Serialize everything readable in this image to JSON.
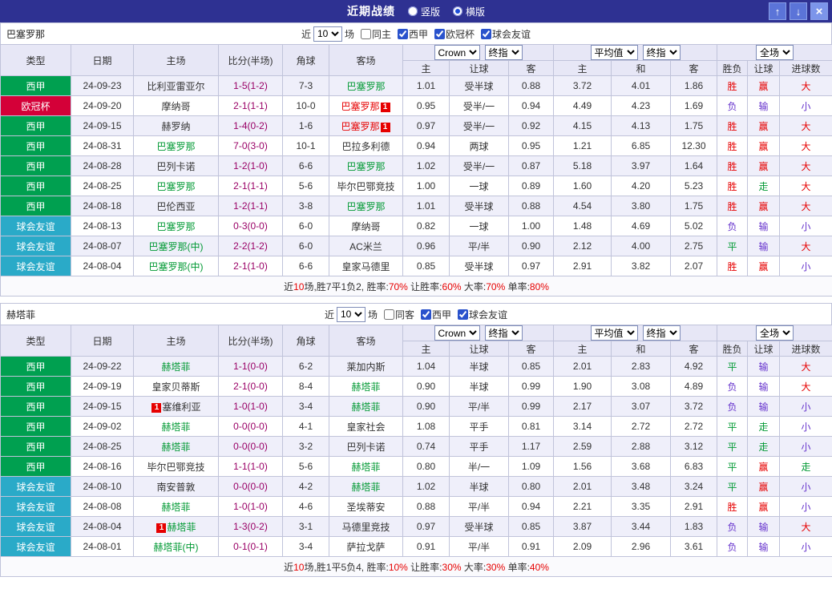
{
  "titlebar": {
    "title": "近期战绩",
    "radios": [
      {
        "label": "竖版",
        "selected": false
      },
      {
        "label": "横版",
        "selected": true
      }
    ],
    "up": "↑",
    "down": "↓",
    "close": "×"
  },
  "labels": {
    "near": "近",
    "games": "场"
  },
  "columns": [
    "类型",
    "日期",
    "主场",
    "比分(半场)",
    "角球",
    "客场",
    "主",
    "让球",
    "客",
    "主",
    "和",
    "客",
    "胜负",
    "让球",
    "进球数"
  ],
  "dropdown_groups": [
    [
      {
        "label": "Crown",
        "name": "bookmaker-select"
      },
      {
        "label": "终指",
        "name": "bookmaker-stage-select"
      }
    ],
    [
      {
        "label": "平均值",
        "name": "average-select"
      },
      {
        "label": "终指",
        "name": "average-stage-select"
      }
    ],
    [
      {
        "label": "全场",
        "name": "scope-select"
      }
    ]
  ],
  "palette": {
    "r": "#e60000",
    "p": "#6633cc",
    "g": "#009933",
    "k": "#333333"
  },
  "league_colors": {
    "西甲": "#00a050",
    "欧冠杯": "#d40038",
    "球会友谊": "#2aaac8"
  },
  "sections": [
    {
      "team": "巴塞罗那",
      "filter": {
        "count": "10",
        "checks": [
          {
            "label": "同主",
            "checked": false,
            "name": "same-home-checkbox"
          },
          {
            "label": "西甲",
            "checked": true,
            "name": "league-laliga-checkbox"
          },
          {
            "label": "欧冠杯",
            "checked": true,
            "name": "league-ucl-checkbox"
          },
          {
            "label": "球会友谊",
            "checked": true,
            "name": "league-friendly-checkbox"
          }
        ]
      },
      "rows": [
        {
          "league": "西甲",
          "date": "24-09-23",
          "home": {
            "t": "比利亚雷亚尔"
          },
          "score": "1-5(1-2)",
          "corners": "7-3",
          "away": {
            "t": "巴塞罗那",
            "c": "g"
          },
          "asia": [
            "1.01",
            "受半球",
            "0.88"
          ],
          "euro": [
            "3.72",
            "4.01",
            "1.86"
          ],
          "res": [
            "胜",
            "赢",
            "大"
          ],
          "rc": [
            "r",
            "r",
            "r"
          ]
        },
        {
          "league": "欧冠杯",
          "date": "24-09-20",
          "home": {
            "t": "摩纳哥"
          },
          "score": "2-1(1-1)",
          "corners": "10-0",
          "away": {
            "t": "巴塞罗那",
            "c": "r",
            "b": "1",
            "bp": "a"
          },
          "asia": [
            "0.95",
            "受半/一",
            "0.94"
          ],
          "euro": [
            "4.49",
            "4.23",
            "1.69"
          ],
          "res": [
            "负",
            "输",
            "小"
          ],
          "rc": [
            "p",
            "p",
            "p"
          ]
        },
        {
          "league": "西甲",
          "date": "24-09-15",
          "home": {
            "t": "赫罗纳"
          },
          "score": "1-4(0-2)",
          "corners": "1-6",
          "away": {
            "t": "巴塞罗那",
            "c": "r",
            "b": "1",
            "bp": "a"
          },
          "asia": [
            "0.97",
            "受半/一",
            "0.92"
          ],
          "euro": [
            "4.15",
            "4.13",
            "1.75"
          ],
          "res": [
            "胜",
            "赢",
            "大"
          ],
          "rc": [
            "r",
            "r",
            "r"
          ]
        },
        {
          "league": "西甲",
          "date": "24-08-31",
          "home": {
            "t": "巴塞罗那",
            "c": "g"
          },
          "score": "7-0(3-0)",
          "corners": "10-1",
          "away": {
            "t": "巴拉多利德"
          },
          "asia": [
            "0.94",
            "两球",
            "0.95"
          ],
          "euro": [
            "1.21",
            "6.85",
            "12.30"
          ],
          "res": [
            "胜",
            "赢",
            "大"
          ],
          "rc": [
            "r",
            "r",
            "r"
          ]
        },
        {
          "league": "西甲",
          "date": "24-08-28",
          "home": {
            "t": "巴列卡诺"
          },
          "score": "1-2(1-0)",
          "corners": "6-6",
          "away": {
            "t": "巴塞罗那",
            "c": "g"
          },
          "asia": [
            "1.02",
            "受半/一",
            "0.87"
          ],
          "euro": [
            "5.18",
            "3.97",
            "1.64"
          ],
          "res": [
            "胜",
            "赢",
            "大"
          ],
          "rc": [
            "r",
            "r",
            "r"
          ]
        },
        {
          "league": "西甲",
          "date": "24-08-25",
          "home": {
            "t": "巴塞罗那",
            "c": "g"
          },
          "score": "2-1(1-1)",
          "corners": "5-6",
          "away": {
            "t": "毕尔巴鄂竞技"
          },
          "asia": [
            "1.00",
            "一球",
            "0.89"
          ],
          "euro": [
            "1.60",
            "4.20",
            "5.23"
          ],
          "res": [
            "胜",
            "走",
            "大"
          ],
          "rc": [
            "r",
            "g",
            "r"
          ]
        },
        {
          "league": "西甲",
          "date": "24-08-18",
          "home": {
            "t": "巴伦西亚"
          },
          "score": "1-2(1-1)",
          "corners": "3-8",
          "away": {
            "t": "巴塞罗那",
            "c": "g"
          },
          "asia": [
            "1.01",
            "受半球",
            "0.88"
          ],
          "euro": [
            "4.54",
            "3.80",
            "1.75"
          ],
          "res": [
            "胜",
            "赢",
            "大"
          ],
          "rc": [
            "r",
            "r",
            "r"
          ]
        },
        {
          "league": "球会友谊",
          "date": "24-08-13",
          "home": {
            "t": "巴塞罗那",
            "c": "g"
          },
          "score": "0-3(0-0)",
          "corners": "6-0",
          "away": {
            "t": "摩纳哥"
          },
          "asia": [
            "0.82",
            "一球",
            "1.00"
          ],
          "euro": [
            "1.48",
            "4.69",
            "5.02"
          ],
          "res": [
            "负",
            "输",
            "小"
          ],
          "rc": [
            "p",
            "p",
            "p"
          ]
        },
        {
          "league": "球会友谊",
          "date": "24-08-07",
          "home": {
            "t": "巴塞罗那(中)",
            "c": "g"
          },
          "score": "2-2(1-2)",
          "corners": "6-0",
          "away": {
            "t": "AC米兰"
          },
          "asia": [
            "0.96",
            "平/半",
            "0.90"
          ],
          "euro": [
            "2.12",
            "4.00",
            "2.75"
          ],
          "res": [
            "平",
            "输",
            "大"
          ],
          "rc": [
            "g",
            "p",
            "r"
          ]
        },
        {
          "league": "球会友谊",
          "date": "24-08-04",
          "home": {
            "t": "巴塞罗那(中)",
            "c": "g"
          },
          "score": "2-1(1-0)",
          "corners": "6-6",
          "away": {
            "t": "皇家马德里"
          },
          "asia": [
            "0.85",
            "受半球",
            "0.97"
          ],
          "euro": [
            "2.91",
            "3.82",
            "2.07"
          ],
          "res": [
            "胜",
            "赢",
            "小"
          ],
          "rc": [
            "r",
            "r",
            "p"
          ]
        }
      ],
      "summary": [
        [
          "近",
          "k"
        ],
        [
          "10",
          "r"
        ],
        [
          "场,胜7平1负2, 胜率:",
          "k"
        ],
        [
          "70%",
          "r"
        ],
        [
          " 让胜率:",
          "k"
        ],
        [
          "60%",
          "r"
        ],
        [
          " 大率:",
          "k"
        ],
        [
          "70%",
          "r"
        ],
        [
          " 单率:",
          "k"
        ],
        [
          "80%",
          "r"
        ]
      ]
    },
    {
      "team": "赫塔菲",
      "filter": {
        "count": "10",
        "checks": [
          {
            "label": "同客",
            "checked": false,
            "name": "same-away-checkbox"
          },
          {
            "label": "西甲",
            "checked": true,
            "name": "league-laliga-checkbox"
          },
          {
            "label": "球会友谊",
            "checked": true,
            "name": "league-friendly-checkbox"
          }
        ]
      },
      "rows": [
        {
          "league": "西甲",
          "date": "24-09-22",
          "home": {
            "t": "赫塔菲",
            "c": "g"
          },
          "score": "1-1(0-0)",
          "corners": "6-2",
          "away": {
            "t": "莱加内斯"
          },
          "asia": [
            "1.04",
            "半球",
            "0.85"
          ],
          "euro": [
            "2.01",
            "2.83",
            "4.92"
          ],
          "res": [
            "平",
            "输",
            "大"
          ],
          "rc": [
            "g",
            "p",
            "r"
          ]
        },
        {
          "league": "西甲",
          "date": "24-09-19",
          "home": {
            "t": "皇家贝蒂斯"
          },
          "score": "2-1(0-0)",
          "corners": "8-4",
          "away": {
            "t": "赫塔菲",
            "c": "g"
          },
          "asia": [
            "0.90",
            "半球",
            "0.99"
          ],
          "euro": [
            "1.90",
            "3.08",
            "4.89"
          ],
          "res": [
            "负",
            "输",
            "大"
          ],
          "rc": [
            "p",
            "p",
            "r"
          ]
        },
        {
          "league": "西甲",
          "date": "24-09-15",
          "home": {
            "t": "塞维利亚",
            "b": "1",
            "bp": "b"
          },
          "score": "1-0(1-0)",
          "corners": "3-4",
          "away": {
            "t": "赫塔菲",
            "c": "g"
          },
          "asia": [
            "0.90",
            "平/半",
            "0.99"
          ],
          "euro": [
            "2.17",
            "3.07",
            "3.72"
          ],
          "res": [
            "负",
            "输",
            "小"
          ],
          "rc": [
            "p",
            "p",
            "p"
          ]
        },
        {
          "league": "西甲",
          "date": "24-09-02",
          "home": {
            "t": "赫塔菲",
            "c": "g"
          },
          "score": "0-0(0-0)",
          "corners": "4-1",
          "away": {
            "t": "皇家社会"
          },
          "asia": [
            "1.08",
            "平手",
            "0.81"
          ],
          "euro": [
            "3.14",
            "2.72",
            "2.72"
          ],
          "res": [
            "平",
            "走",
            "小"
          ],
          "rc": [
            "g",
            "g",
            "p"
          ]
        },
        {
          "league": "西甲",
          "date": "24-08-25",
          "home": {
            "t": "赫塔菲",
            "c": "g"
          },
          "score": "0-0(0-0)",
          "corners": "3-2",
          "away": {
            "t": "巴列卡诺"
          },
          "asia": [
            "0.74",
            "平手",
            "1.17"
          ],
          "euro": [
            "2.59",
            "2.88",
            "3.12"
          ],
          "res": [
            "平",
            "走",
            "小"
          ],
          "rc": [
            "g",
            "g",
            "p"
          ]
        },
        {
          "league": "西甲",
          "date": "24-08-16",
          "home": {
            "t": "毕尔巴鄂竞技"
          },
          "score": "1-1(1-0)",
          "corners": "5-6",
          "away": {
            "t": "赫塔菲",
            "c": "g"
          },
          "asia": [
            "0.80",
            "半/一",
            "1.09"
          ],
          "euro": [
            "1.56",
            "3.68",
            "6.83"
          ],
          "res": [
            "平",
            "赢",
            "走"
          ],
          "rc": [
            "g",
            "r",
            "g"
          ]
        },
        {
          "league": "球会友谊",
          "date": "24-08-10",
          "home": {
            "t": "南安普敦"
          },
          "score": "0-0(0-0)",
          "corners": "4-2",
          "away": {
            "t": "赫塔菲",
            "c": "g"
          },
          "asia": [
            "1.02",
            "半球",
            "0.80"
          ],
          "euro": [
            "2.01",
            "3.48",
            "3.24"
          ],
          "res": [
            "平",
            "赢",
            "小"
          ],
          "rc": [
            "g",
            "r",
            "p"
          ]
        },
        {
          "league": "球会友谊",
          "date": "24-08-08",
          "home": {
            "t": "赫塔菲",
            "c": "g"
          },
          "score": "1-0(1-0)",
          "corners": "4-6",
          "away": {
            "t": "圣埃蒂安"
          },
          "asia": [
            "0.88",
            "平/半",
            "0.94"
          ],
          "euro": [
            "2.21",
            "3.35",
            "2.91"
          ],
          "res": [
            "胜",
            "赢",
            "小"
          ],
          "rc": [
            "r",
            "r",
            "p"
          ]
        },
        {
          "league": "球会友谊",
          "date": "24-08-04",
          "home": {
            "t": "赫塔菲",
            "c": "g",
            "b": "1",
            "bp": "b"
          },
          "score": "1-3(0-2)",
          "corners": "3-1",
          "away": {
            "t": "马德里竞技"
          },
          "asia": [
            "0.97",
            "受半球",
            "0.85"
          ],
          "euro": [
            "3.87",
            "3.44",
            "1.83"
          ],
          "res": [
            "负",
            "输",
            "大"
          ],
          "rc": [
            "p",
            "p",
            "r"
          ]
        },
        {
          "league": "球会友谊",
          "date": "24-08-01",
          "home": {
            "t": "赫塔菲(中)",
            "c": "g"
          },
          "score": "0-1(0-1)",
          "corners": "3-4",
          "away": {
            "t": "萨拉戈萨"
          },
          "asia": [
            "0.91",
            "平/半",
            "0.91"
          ],
          "euro": [
            "2.09",
            "2.96",
            "3.61"
          ],
          "res": [
            "负",
            "输",
            "小"
          ],
          "rc": [
            "p",
            "p",
            "p"
          ]
        }
      ],
      "summary": [
        [
          "近",
          "k"
        ],
        [
          "10",
          "r"
        ],
        [
          "场,胜1平5负4, 胜率:",
          "k"
        ],
        [
          "10%",
          "r"
        ],
        [
          " 让胜率:",
          "k"
        ],
        [
          "30%",
          "r"
        ],
        [
          " 大率:",
          "k"
        ],
        [
          "30%",
          "r"
        ],
        [
          " 单率:",
          "k"
        ],
        [
          "40%",
          "r"
        ]
      ]
    }
  ]
}
